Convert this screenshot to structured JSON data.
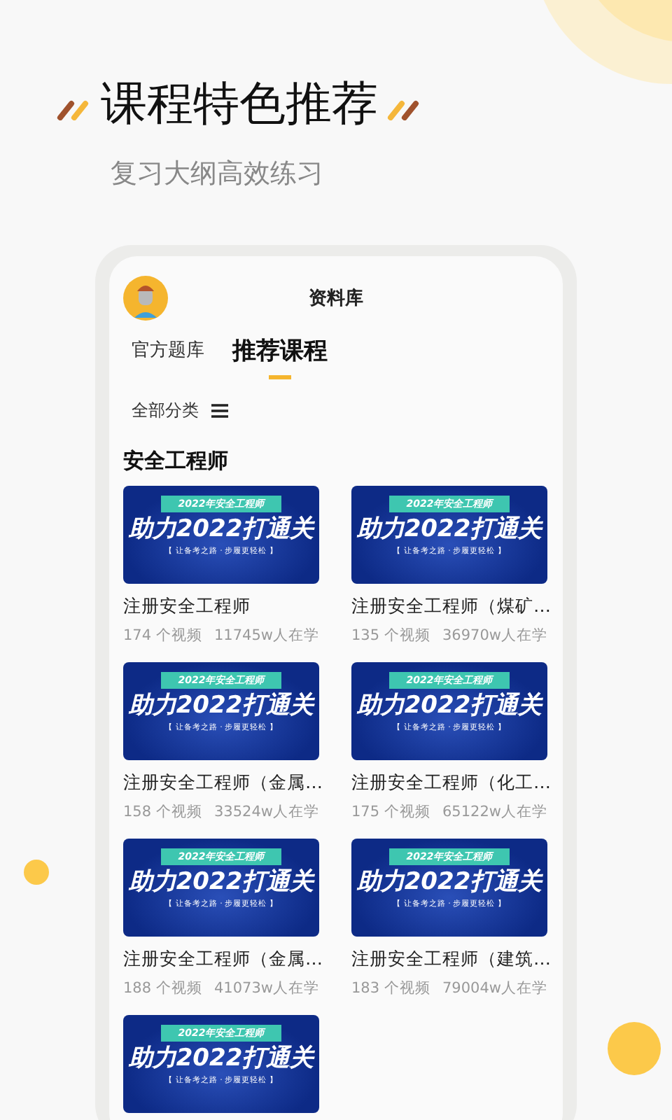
{
  "headline": "课程特色推荐",
  "subheadline": "复习大纲高效练习",
  "app": {
    "title": "资料库",
    "tabs": [
      {
        "label": "官方题库",
        "selected": false
      },
      {
        "label": "推荐课程",
        "selected": true
      }
    ],
    "filter": "全部分类",
    "section": "安全工程师",
    "courses": [
      {
        "banner": {
          "tag": "2022年安全工程师",
          "headline": "助力2022打通关",
          "slogan": "【 让备考之路 · 步履更轻松 】"
        },
        "title": "注册安全工程师",
        "videos": "174 个视频",
        "learners": "11745w人在学"
      },
      {
        "banner": {
          "tag": "2022年安全工程师",
          "headline": "助力2022打通关",
          "slogan": "【 让备考之路 · 步履更轻松 】"
        },
        "title": "注册安全工程师（煤矿…",
        "videos": "135 个视频",
        "learners": "36970w人在学"
      },
      {
        "banner": {
          "tag": "2022年安全工程师",
          "headline": "助力2022打通关",
          "slogan": "【 让备考之路 · 步履更轻松 】"
        },
        "title": "注册安全工程师（金属…",
        "videos": "158 个视频",
        "learners": "33524w人在学"
      },
      {
        "banner": {
          "tag": "2022年安全工程师",
          "headline": "助力2022打通关",
          "slogan": "【 让备考之路 · 步履更轻松 】"
        },
        "title": "注册安全工程师（化工…",
        "videos": "175 个视频",
        "learners": "65122w人在学"
      },
      {
        "banner": {
          "tag": "2022年安全工程师",
          "headline": "助力2022打通关",
          "slogan": "【 让备考之路 · 步履更轻松 】"
        },
        "title": "注册安全工程师（金属…",
        "videos": "188 个视频",
        "learners": "41073w人在学"
      },
      {
        "banner": {
          "tag": "2022年安全工程师",
          "headline": "助力2022打通关",
          "slogan": "【 让备考之路 · 步履更轻松 】"
        },
        "title": "注册安全工程师（建筑…",
        "videos": "183 个视频",
        "learners": "79004w人在学"
      },
      {
        "banner": {
          "tag": "2022年安全工程师",
          "headline": "助力2022打通关",
          "slogan": "【 让备考之路 · 步履更轻松 】"
        }
      }
    ]
  }
}
